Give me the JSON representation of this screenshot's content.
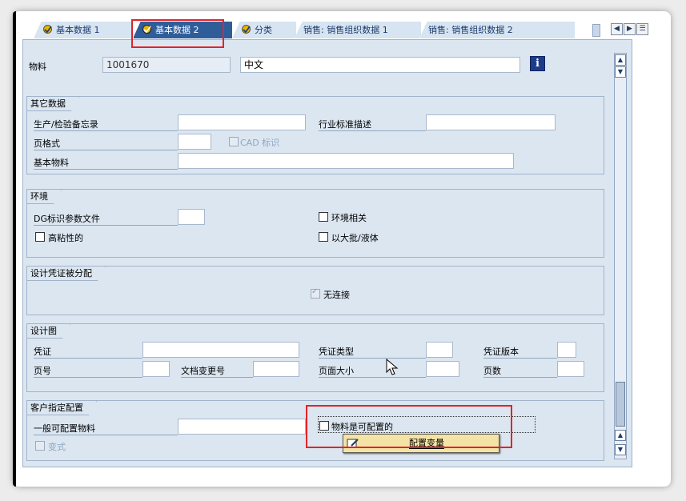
{
  "tabs": [
    {
      "label": "基本数据 1",
      "icon": "tab-check-icon"
    },
    {
      "label": "基本数据 2",
      "icon": "tab-check-icon",
      "active": true
    },
    {
      "label": "分类",
      "icon": "tab-check-icon"
    },
    {
      "label": "销售: 销售组织数据 1"
    },
    {
      "label": "销售: 销售组织数据 2"
    }
  ],
  "header": {
    "material_label": "物料",
    "material_value": "1001670",
    "description_value": "中文",
    "info_icon": "i"
  },
  "other_data": {
    "title": "其它数据",
    "prod_memo_label": "生产/检验备忘录",
    "industry_desc_label": "行业标准描述",
    "page_format_label": "页格式",
    "cad_label": "CAD 标识",
    "basic_material_label": "基本物料"
  },
  "environment": {
    "title": "环境",
    "dg_label": "DG标识参数文件",
    "env_relevant_label": "环境相关",
    "high_viscous_label": "高粘性的",
    "bulk_liquid_label": "以大批/液体"
  },
  "design_docs": {
    "title": "设计凭证被分配",
    "no_link_label": "无连接"
  },
  "drawing": {
    "title": "设计图",
    "doc_label": "凭证",
    "doc_type_label": "凭证类型",
    "doc_version_label": "凭证版本",
    "page_no_label": "页号",
    "doc_change_label": "文档变更号",
    "page_size_label": "页面大小",
    "page_count_label": "页数"
  },
  "client_config": {
    "title": "客户指定配置",
    "general_config_label": "一般可配置物料",
    "material_configurable_label": "物料是可配置的",
    "variant_label": "变式"
  },
  "popup": {
    "label": "配置变量"
  },
  "colors": {
    "panel_bg": "#dbe6f1",
    "tab_active": "#2f5d9a",
    "highlight_red": "#e0242b",
    "popup_bg": "#f3e4a5"
  }
}
